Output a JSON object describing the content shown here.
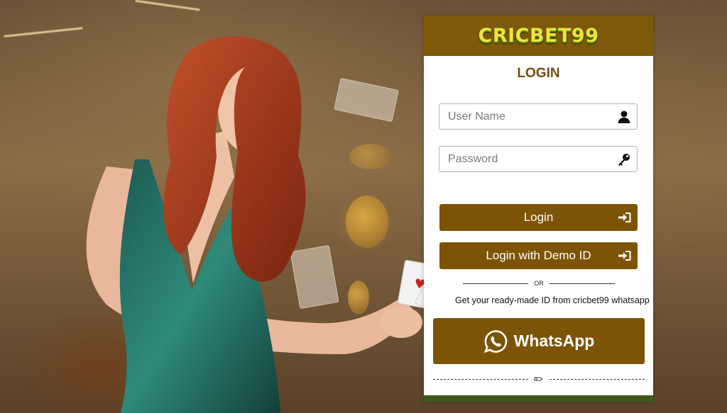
{
  "brand": {
    "name": "CRICBET99",
    "primary_color": "#7d5406",
    "header_color": "#7d5a0b",
    "footer_color": "#3d5a1a"
  },
  "login": {
    "title": "LOGIN",
    "username_placeholder": "User Name",
    "password_placeholder": "Password",
    "login_label": "Login",
    "demo_label": "Login with Demo ID",
    "or_label": "OR",
    "hint": "Get your ready-made ID from cricbet99 whatsapp",
    "whatsapp_label": "WhatsApp"
  },
  "icons": {
    "username": "user-icon",
    "password": "key-icon",
    "login": "sign-in-icon",
    "demo": "sign-in-icon",
    "whatsapp": "whatsapp-icon",
    "footer": "hand-icon"
  }
}
